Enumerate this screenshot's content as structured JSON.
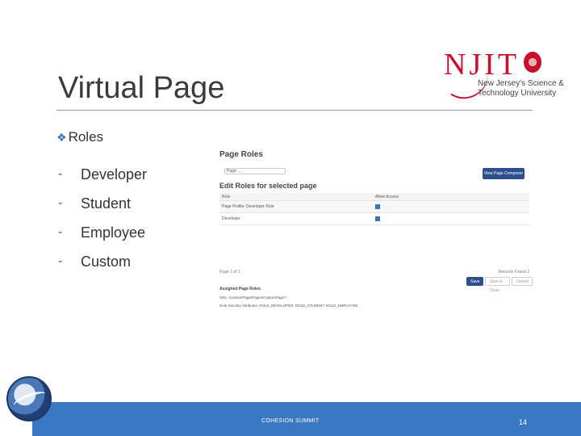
{
  "slide": {
    "title": "Virtual Page",
    "section_label": "Roles",
    "roles": [
      "Developer",
      "Student",
      "Employee",
      "Custom"
    ],
    "bullet_dash": "-"
  },
  "logo": {
    "wordmark": "NJIT",
    "line1": "New Jersey's Science &",
    "line2": "Technology University",
    "brand_color": "#c8102e"
  },
  "screenshot": {
    "heading": "Page Roles",
    "page_select_value": "Page: ...",
    "view_button": "View Page Composer",
    "subheading": "Edit Roles for selected page",
    "columns": [
      "Role",
      "Allow Access"
    ],
    "rows": [
      {
        "role": "Page Profile: Developer Role",
        "checked": true
      },
      {
        "role": "Developer",
        "checked": true
      }
    ],
    "pager_left": "Page 1 of 1",
    "pager_right": "Records Found 2",
    "buttons": [
      "Save",
      "Save & Close",
      "Cancel"
    ],
    "details_title": "Assigned Page Roles",
    "details_lines": [
      "URL: /custom/Page/Pages/CustomPage?...",
      "Role Security Attributes: ROLE_DEVELOPER, ROLE_STUDENT, ROLE_EMPLOYEE"
    ]
  },
  "footer": {
    "event": "COHESION SUMMIT",
    "page_number": "14",
    "bar_color": "#3b78c4"
  }
}
